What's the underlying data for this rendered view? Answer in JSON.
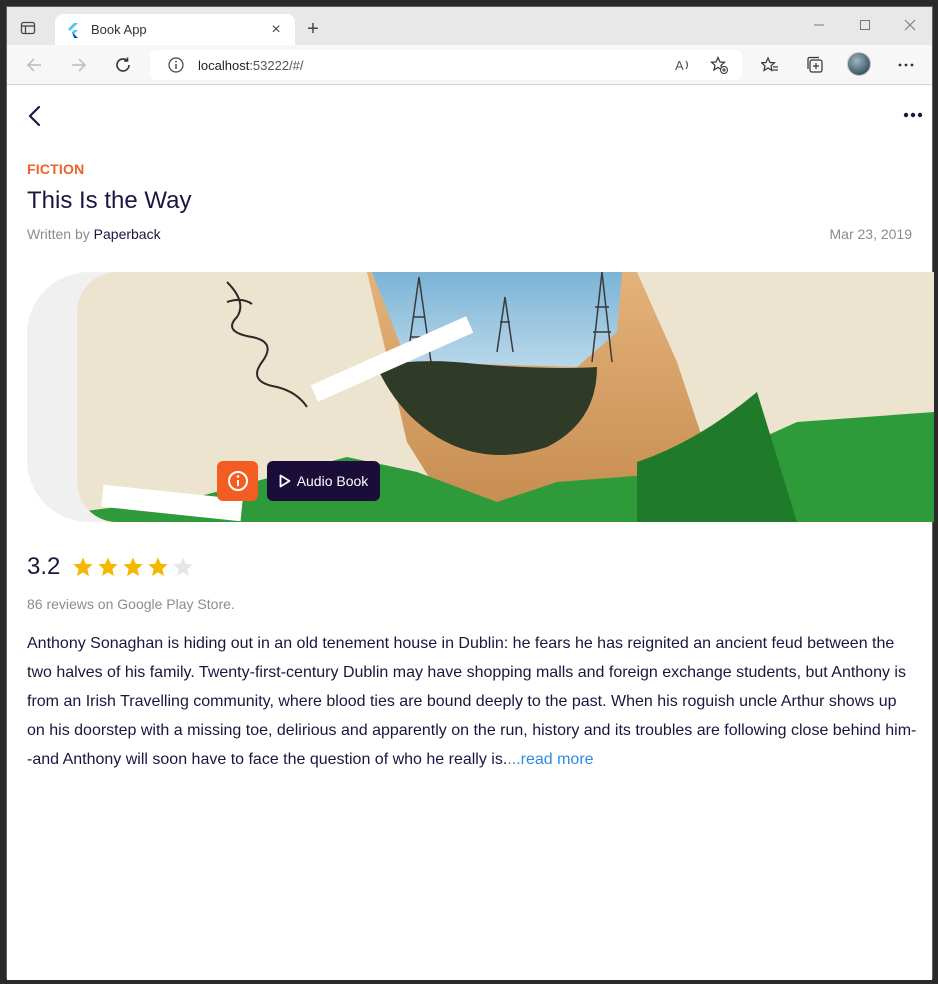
{
  "browser": {
    "tab_title": "Book App",
    "url_host": "localhost",
    "url_rest": ":53222/#/",
    "tab_close": "×",
    "new_tab": "+"
  },
  "book": {
    "category": "FICTION",
    "title": "This Is the Way",
    "written_by_label": "Written by ",
    "author": "Paperback",
    "date": "Mar 23, 2019",
    "rating": "3.2",
    "rating_value": 3.2,
    "rating_max": 5,
    "reviews": "86 reviews on Google Play Store.",
    "description": "Anthony Sonaghan is hiding out in an old tenement house in Dublin: he fears he has reignited an ancient feud between the two halves of his family. Twenty-first-century Dublin may have shopping malls and foreign exchange students, but Anthony is from an Irish Travelling community, where blood ties are bound deeply to the past. When his roguish uncle Arthur shows up on his doorstep with a missing toe, delirious and apparently on the run, history and its troubles are following close behind him--and Anthony will soon have to face the question of who he really is.",
    "read_more": "...read more"
  },
  "actions": {
    "audio_label": "Audio Book"
  },
  "colors": {
    "accent_orange": "#f45d22",
    "primary_dark": "#1a0d3a",
    "star_gold": "#f5b800",
    "star_empty": "#e6e6e6",
    "link_blue": "#2a8de0"
  },
  "icons": {
    "back": "chevron-left-icon",
    "more": "more-horizontal-icon",
    "info": "info-icon",
    "play": "play-icon"
  }
}
